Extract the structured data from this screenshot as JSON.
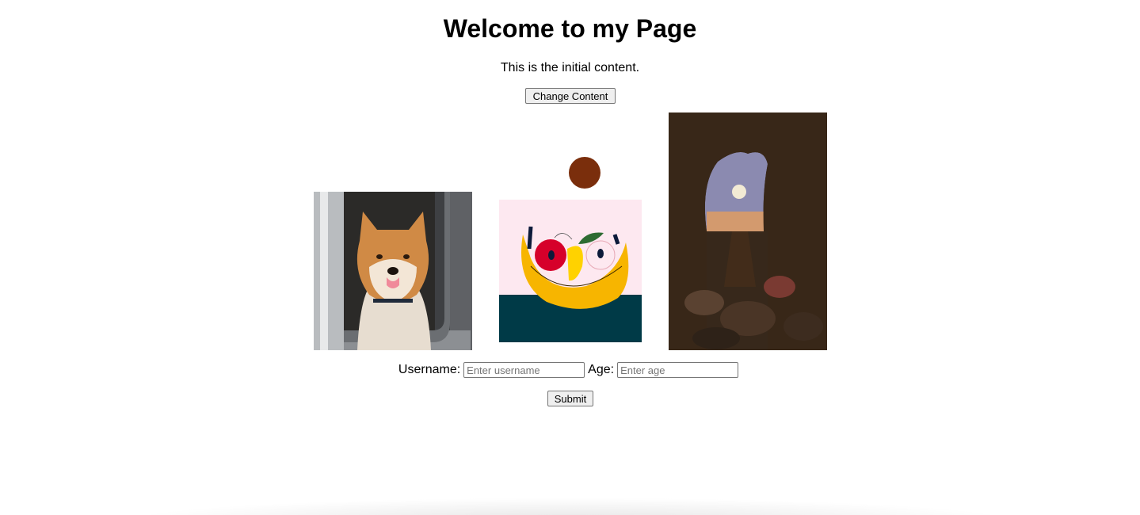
{
  "page": {
    "title": "Welcome to my Page",
    "content": "This is the initial content.",
    "change_button": "Change Content"
  },
  "gallery": [
    {
      "name": "shiba-dog-photo",
      "kind": "photo"
    },
    {
      "name": "fruit-bowl-illustration",
      "kind": "illustration"
    },
    {
      "name": "sea-cave-moon-photo",
      "kind": "photo"
    }
  ],
  "form": {
    "username_label": "Username:",
    "username_placeholder": "Enter username",
    "age_label": "Age:",
    "age_placeholder": "Enter age",
    "submit_label": "Submit"
  },
  "colors": {
    "art_background": "#fde8f0",
    "art_sea": "#003a47",
    "art_banana": "#f7b500",
    "art_ball": "#7a2e0c",
    "art_red": "#d6002a"
  }
}
